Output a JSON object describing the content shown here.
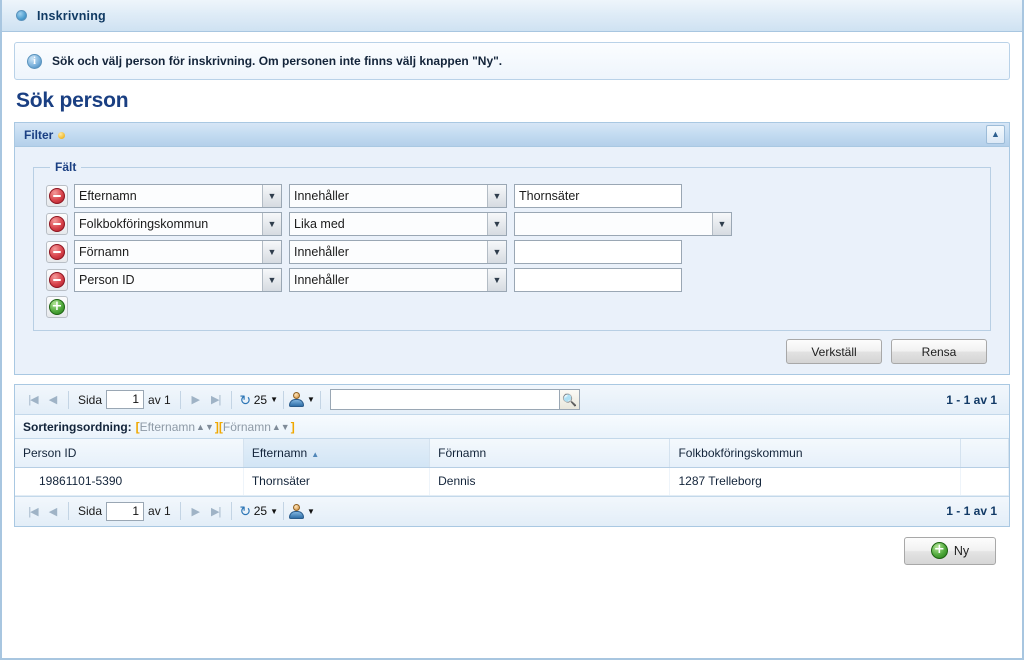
{
  "window": {
    "title": "Inskrivning",
    "title_icon": "blue-circle-icon"
  },
  "info": {
    "icon": "info-icon",
    "glyph": "i",
    "text": "Sök och välj person för inskrivning. Om personen inte finns välj knappen \"Ny\"."
  },
  "page_title": "Sök person",
  "filter_panel": {
    "title": "Filter",
    "dirty_marker": "yellow-dot",
    "collapse_glyph": "▲",
    "fieldset_legend": "Fält",
    "rows": [
      {
        "remove_glyph": "–",
        "field": "Efternamn",
        "operator": "Innehåller",
        "value": "Thornsäter",
        "value_type": "text"
      },
      {
        "remove_glyph": "–",
        "field": "Folkbokföringskommun",
        "operator": "Lika med",
        "value": "",
        "value_type": "select"
      },
      {
        "remove_glyph": "–",
        "field": "Förnamn",
        "operator": "Innehåller",
        "value": "",
        "value_type": "text"
      },
      {
        "remove_glyph": "–",
        "field": "Person ID",
        "operator": "Innehåller",
        "value": "",
        "value_type": "text"
      }
    ],
    "add_row_glyph": "+",
    "apply_label": "Verkställ",
    "clear_label": "Rensa"
  },
  "pager": {
    "first_glyph": "|◀",
    "prev_glyph": "◀",
    "page_label": "Sida",
    "page_value": "1",
    "of_label": "av 1",
    "next_glyph": "▶",
    "last_glyph": "▶|",
    "refresh_glyph": "↻",
    "page_size": "25",
    "caret": "▼",
    "person_icon": "person-icon",
    "search_value": "",
    "search_placeholder": "",
    "search_icon": "magnifier-icon",
    "count": "1 - 1 av 1"
  },
  "sort": {
    "label": "Sorteringsordning:",
    "open_bracket": "[",
    "close_bracket": "]",
    "fields": [
      "Efternamn",
      "Förnamn"
    ],
    "arrow_glyph": "▲▼"
  },
  "table": {
    "columns": [
      "Person ID",
      "Efternamn",
      "Förnamn",
      "Folkbokföringskommun",
      ""
    ],
    "sorted_column": "Efternamn",
    "sort_direction_glyph": "▲",
    "rows": [
      {
        "person_id": "19861101-5390",
        "efternamn": "Thornsäter",
        "fornamn": "Dennis",
        "kommun": "1287 Trelleborg",
        "extra": ""
      }
    ]
  },
  "footer": {
    "new_label": "Ny",
    "new_glyph": "+"
  },
  "colors": {
    "accent_blue": "#1a3f82",
    "panel_border": "#a9c8e2",
    "panel_bg": "#eaf1fa",
    "remove_red": "#d8434b",
    "add_green": "#4fa83b",
    "dirty_yellow": "#f0b92c"
  }
}
